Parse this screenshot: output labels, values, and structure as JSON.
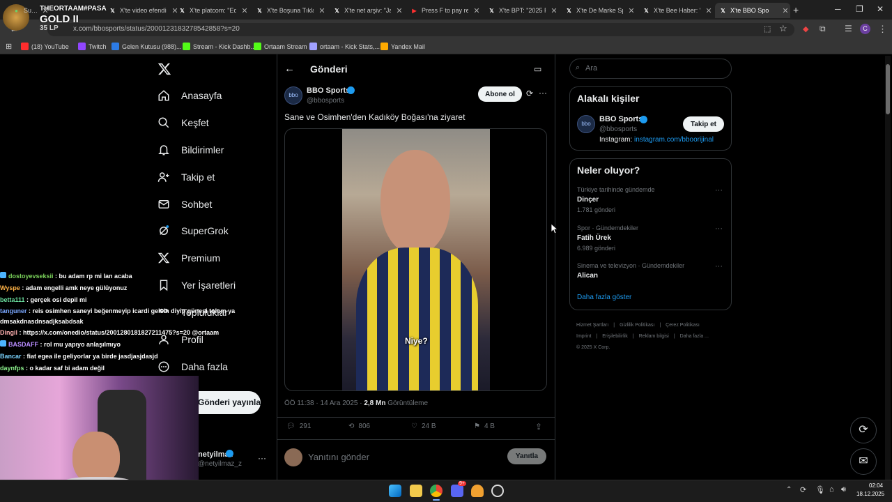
{
  "browser": {
    "tabs": [
      {
        "label": "Su…",
        "icon": "logo-icon",
        "color": "#6cd46c"
      },
      {
        "label": "X'te video efendis",
        "icon": "x-icon",
        "color": "#ffffff"
      },
      {
        "label": "X'te platcom: \"Edi",
        "icon": "x-icon",
        "color": "#ffffff"
      },
      {
        "label": "X'te Boşuna Tıklan",
        "icon": "x-icon",
        "color": "#ffffff"
      },
      {
        "label": "X'te net arşiv: \"Ja",
        "icon": "x-icon",
        "color": "#ffffff"
      },
      {
        "label": "Press F to pay resp",
        "icon": "youtube-icon",
        "color": "#ff3030"
      },
      {
        "label": "X'te BPT: \"2025 Fi",
        "icon": "x-icon",
        "color": "#ffffff"
      },
      {
        "label": "X'te De Marke Spo",
        "icon": "x-icon",
        "color": "#ffffff"
      },
      {
        "label": "X'te Bee Haber: \"I",
        "icon": "x-icon",
        "color": "#ffffff"
      },
      {
        "label": "X'te BBO Spo",
        "icon": "x-icon",
        "color": "#ffffff",
        "active": true
      }
    ],
    "new_tab": "+",
    "url": "x.com/bbosports/status/2000123183278542858?s=20",
    "bookmarks": [
      {
        "label": "(18) YouTube",
        "icon": "youtube-icon",
        "color": "#ff2d2d"
      },
      {
        "label": "Twitch",
        "icon": "twitch-icon",
        "color": "#9146ff"
      },
      {
        "label": "Gelen Kutusu (988)...",
        "icon": "outlook-icon",
        "color": "#2c7be5"
      },
      {
        "label": "Stream - Kick Dashb...",
        "icon": "kick-icon",
        "color": "#53fc18"
      },
      {
        "label": "Ortaam Stream",
        "icon": "kick-icon",
        "color": "#53fc18"
      },
      {
        "label": "ortaam - Kick Stats,...",
        "icon": "kickstats-icon",
        "color": "#a0a0ff"
      },
      {
        "label": "Yandex Mail",
        "icon": "mail-icon",
        "color": "#ffaa00"
      }
    ]
  },
  "stream_overlay": {
    "name": "THEORTAAM#PASA",
    "rank": "GOLD II",
    "lp": "35 LP",
    "chat": [
      {
        "user": "dostoyevseksii",
        "user_color": "#7ad15a",
        "text": " : bu adam rp mi lan acaba",
        "badge": true
      },
      {
        "user": "Wyspe",
        "user_color": "#ffb347",
        "text": " : adam engelli amk neye gülüyonuz"
      },
      {
        "user": "betta111",
        "user_color": "#6be0a0",
        "text": " : gerçek osi depil mi"
      },
      {
        "user": "tanguner",
        "user_color": "#7aa7ff",
        "text": " : reis osimhen saneyi beğenmeyip icardi gelsin diyip güneşi tolum ya dmsakdnasdnsadjksabdsak"
      },
      {
        "user": "Dingil",
        "user_color": "#ffb0b0",
        "text": " : https://x.com/onedio/status/2001280181827211475?s=20 @ortaam"
      },
      {
        "user": "BASDAFF",
        "user_color": "#b98cff",
        "text": " : rol mu yapıyo anlaşılmıyo",
        "badge": true
      },
      {
        "user": "Bancar",
        "user_color": "#7bd4ff",
        "text": " : fiat egea ile geliyorlar ya birde jasdjasjdasjd"
      },
      {
        "user": "daynfps",
        "user_color": "#8cf08c",
        "text": " : o kadar saf bi adam değil"
      }
    ]
  },
  "x": {
    "nav": [
      {
        "label": "Anasayfa",
        "icon": "home-icon"
      },
      {
        "label": "Keşfet",
        "icon": "search-icon"
      },
      {
        "label": "Bildirimler",
        "icon": "bell-icon"
      },
      {
        "label": "Takip et",
        "icon": "follow-icon"
      },
      {
        "label": "Sohbet",
        "icon": "mail-icon"
      },
      {
        "label": "SuperGrok",
        "icon": "grok-icon"
      },
      {
        "label": "Premium",
        "icon": "x-logo-icon"
      },
      {
        "label": "Yer İşaretleri",
        "icon": "bookmark-icon"
      },
      {
        "label": "Topluluklar",
        "icon": "communities-icon"
      },
      {
        "label": "Profil",
        "icon": "profile-icon"
      },
      {
        "label": "Daha fazla",
        "icon": "more-icon"
      }
    ],
    "post_button": "Gönderi yayınla",
    "account": {
      "name": "netyilmaz",
      "handle": "@netyilmaz_z"
    },
    "header": "Gönderi",
    "post": {
      "author": "BBO Sports",
      "handle": "@bbosports",
      "avatar_text": "bbo",
      "subscribe": "Abone ol",
      "text": "Sane ve Osimhen'den Kadıköy Boğası'na ziyaret",
      "video_caption": "Niye?",
      "time": "ÖÖ 11:38 · 14 Ara 2025 · ",
      "views": "2,8 Mn",
      "views_label": " Görüntüleme",
      "replies": "291",
      "reposts": "806",
      "likes": "24 B",
      "bookmarks": "4 B",
      "reply_placeholder": "Yanıtını gönder",
      "reply_button": "Yanıtla"
    },
    "search_placeholder": "Ara",
    "related": {
      "title": "Alakalı kişiler",
      "name": "BBO Sports",
      "handle": "@bbosports",
      "follow": "Takip et",
      "bio_prefix": "Instagram: ",
      "bio_link": "instagram.com/bboorijinal"
    },
    "trends": {
      "title": "Neler oluyor?",
      "items": [
        {
          "meta": "Türkiye tarihinde gündemde",
          "name": "Dinçer",
          "count": "1.781 gönderi"
        },
        {
          "meta": "Spor · Gündemdekiler",
          "name": "Fatih Ürek",
          "count": "6.989 gönderi"
        },
        {
          "meta": "Sinema ve televizyon · Gündemdekiler",
          "name": "Alican",
          "count": ""
        }
      ],
      "more": "Daha fazla göster"
    },
    "footer": {
      "row1": [
        "Hizmet Şartları",
        "Gizlilik Politikası",
        "Çerez Politikası"
      ],
      "row2": [
        "Imprint",
        "Erişilebilirlik",
        "Reklam bilgisi",
        "Daha fazla ..."
      ],
      "copyright": "© 2025 X Corp."
    },
    "accent": "#1d9bf0"
  },
  "taskbar": {
    "time": "02:04",
    "date": "18.12.2025",
    "apps": [
      "windows-icon",
      "explorer-icon",
      "chrome-icon",
      "discord-icon",
      "app-icon",
      "obs-icon"
    ],
    "discord_badge": "9+"
  }
}
